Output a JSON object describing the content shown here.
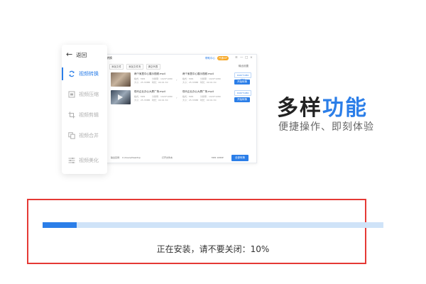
{
  "preview": {
    "title": "转换",
    "help_label": "帮助中心",
    "vip_label": "开通VIP",
    "window_controls": [
      "≡",
      "—",
      "□",
      "×"
    ],
    "toolbar": [
      "添加文件",
      "添加文件夹",
      "清空列表"
    ],
    "settings_label": "输出设置",
    "rows": [
      {
        "thumb": "room",
        "source_name": "两个家居中心展示视频.mp4",
        "source_meta": [
          "格式：MP4",
          "分辨率：1920*1080",
          "大小：25.33MB",
          "时长：00:01:30"
        ],
        "target_name": "两个家居中心展示视频.mp4",
        "target_meta": [
          "格式：MP4",
          "分辨率：1920*1080",
          "大小：25.33MB",
          "时长：00:01:30"
        ],
        "output_label": "1920*1080 MP4",
        "convert_label": "开始转换"
      },
      {
        "thumb": "office",
        "source_name": "现代企业办公大厦广场.mp4",
        "source_meta": [
          "格式：MP4",
          "分辨率：1920*1080",
          "大小：25.33MB",
          "时长：00:01:30"
        ],
        "target_name": "现代企业办公大厦广场.mp4",
        "target_meta": [
          "格式：MP4",
          "分辨率：1920*1080",
          "大小：25.33MB",
          "时长：00:01:30"
        ],
        "output_label": "1920*1080",
        "convert_label": "开始转换"
      }
    ],
    "footer": {
      "dir_label": "输出目录：",
      "dir_value": "C:/Users/Desktop",
      "open_label": "打开文件夹",
      "format_label": "MP4 1080P",
      "convert_all_label": "全部转换"
    }
  },
  "menu": {
    "back_label": "返回",
    "items": [
      {
        "label": "视频转换",
        "icon": "refresh-icon",
        "active": true
      },
      {
        "label": "视频压缩",
        "icon": "compress-icon",
        "active": false
      },
      {
        "label": "视频剪辑",
        "icon": "crop-icon",
        "active": false
      },
      {
        "label": "视频合并",
        "icon": "merge-icon",
        "active": false
      },
      {
        "label": "视频美化",
        "icon": "sliders-icon",
        "active": false
      }
    ]
  },
  "headline": {
    "dark": "多样",
    "blue": "功能",
    "sub": "便捷操作、即刻体验"
  },
  "progress": {
    "percent": 10,
    "status_text": "正在安装，请不要关闭：10%"
  },
  "colors": {
    "accent": "#2b7ee8",
    "track": "#cfe3f8",
    "frame": "#e53935"
  }
}
